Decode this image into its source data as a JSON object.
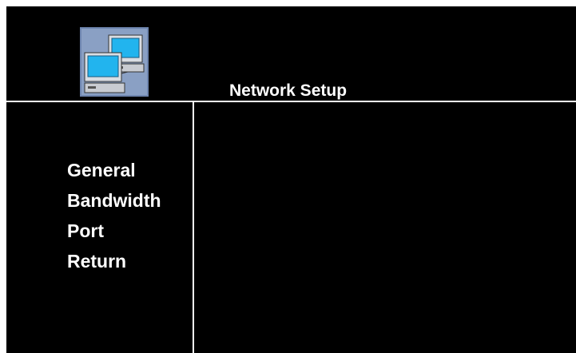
{
  "header": {
    "title": "Network Setup",
    "icon": "network-computers-icon"
  },
  "menu": {
    "items": [
      {
        "label": "General"
      },
      {
        "label": "Bandwidth"
      },
      {
        "label": "Port"
      },
      {
        "label": "Return"
      }
    ]
  },
  "colors": {
    "background": "#000000",
    "text": "#ffffff",
    "divider": "#ffffff",
    "icon_frame": "#6f86b0",
    "icon_screen": "#22b4ee"
  }
}
